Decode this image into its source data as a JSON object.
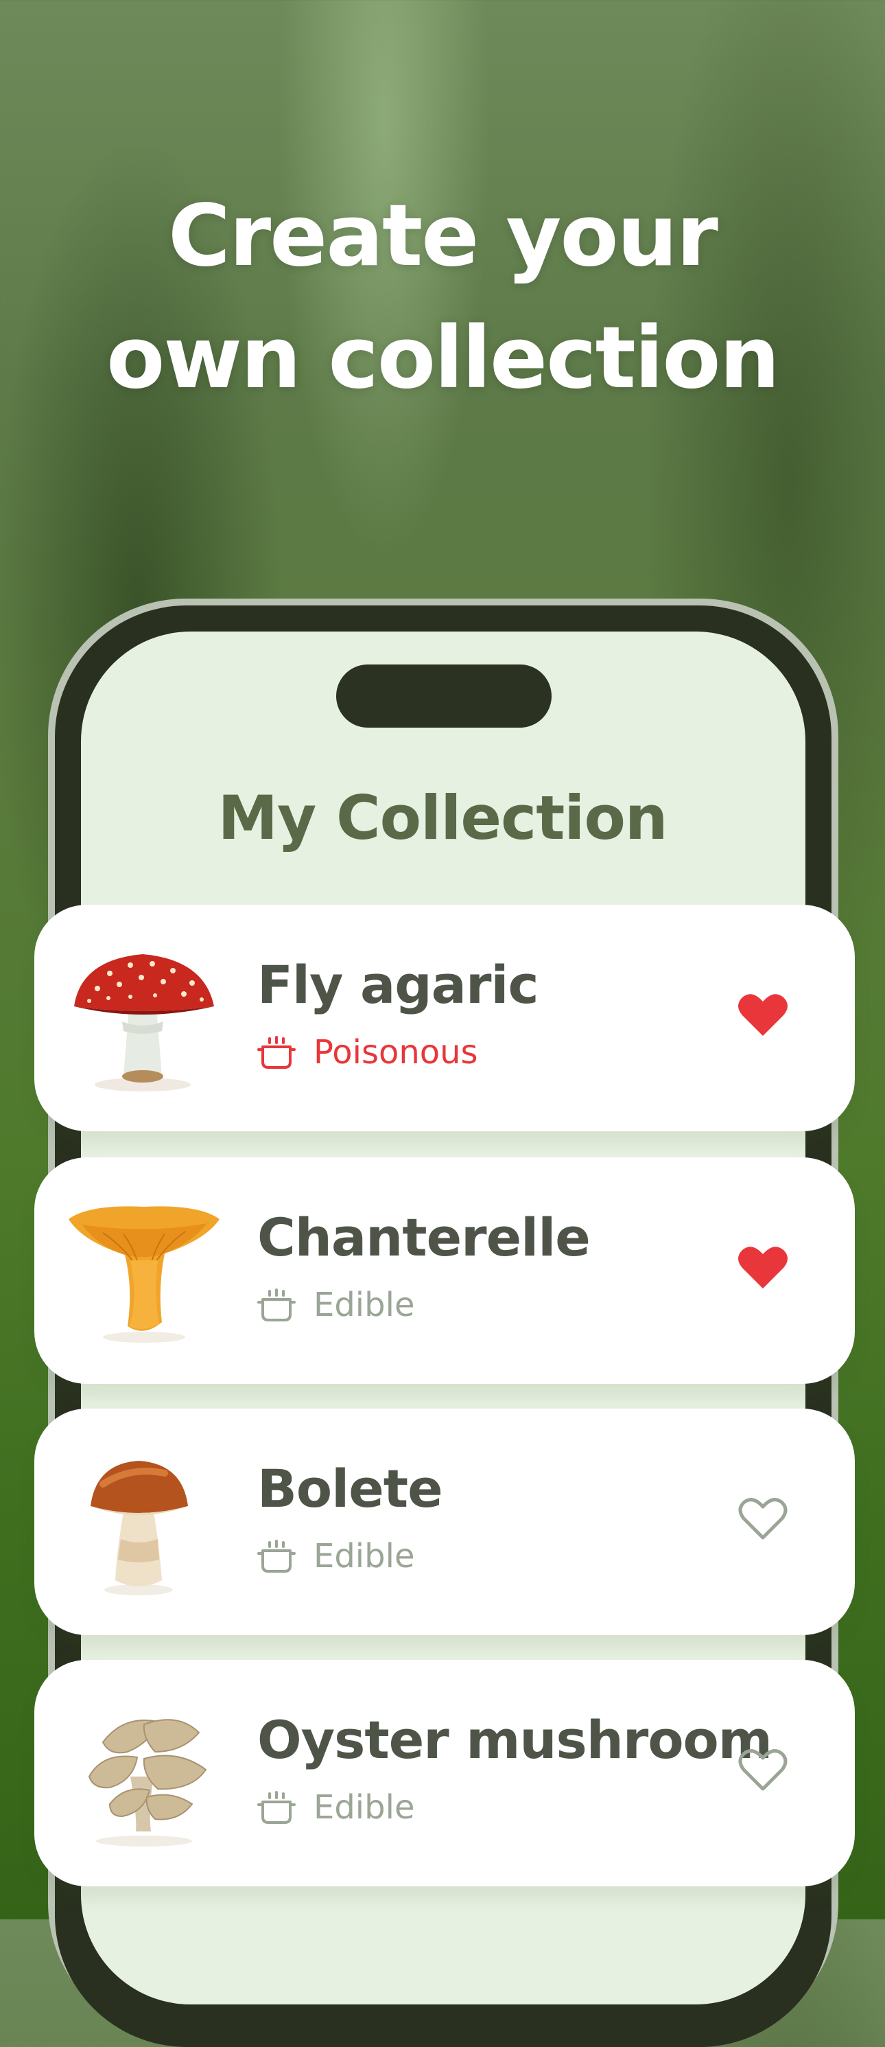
{
  "headline": {
    "line1": "Create your",
    "line2": "own collection"
  },
  "screen": {
    "title": "My Collection"
  },
  "items": [
    {
      "name": "Fly agaric",
      "status": "Poisonous",
      "favorite": true
    },
    {
      "name": "Chanterelle",
      "status": "Edible",
      "favorite": true
    },
    {
      "name": "Bolete",
      "status": "Edible",
      "favorite": false
    },
    {
      "name": "Oyster mushroom",
      "status": "Edible",
      "favorite": false
    }
  ],
  "colors": {
    "poisonous": "#e8363a",
    "edible_text": "#9aa596",
    "heart_filled": "#e8363a",
    "heart_outline": "#9aa596",
    "screen_bg": "#e7f1e1"
  }
}
